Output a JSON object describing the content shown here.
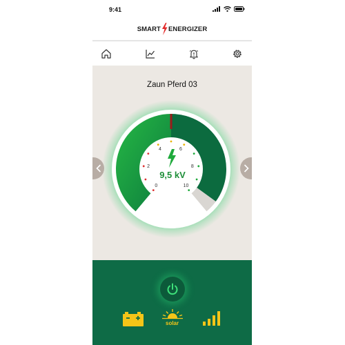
{
  "status_bar": {
    "time": "9:41"
  },
  "app": {
    "logo_left": "SMART",
    "logo_right": "ENERGIZER"
  },
  "nav": {
    "items": [
      "home-icon",
      "chart-icon",
      "alarm-bell-icon",
      "gear-icon"
    ]
  },
  "device": {
    "name": "Zaun Pferd 03"
  },
  "gauge": {
    "value": "9,5 kV",
    "level_kv": 9.5,
    "ticks": [
      "0",
      "2",
      "4",
      "6",
      "8",
      "10"
    ],
    "colors": {
      "ok": "#1faa3c",
      "dark": "#0c6b3f",
      "alarm": "#9b1b1b"
    }
  },
  "footer": {
    "power_icon": "power-icon",
    "battery_icon": "battery-icon",
    "solar_label": "solar",
    "signal_icon": "signal-strength-icon"
  }
}
